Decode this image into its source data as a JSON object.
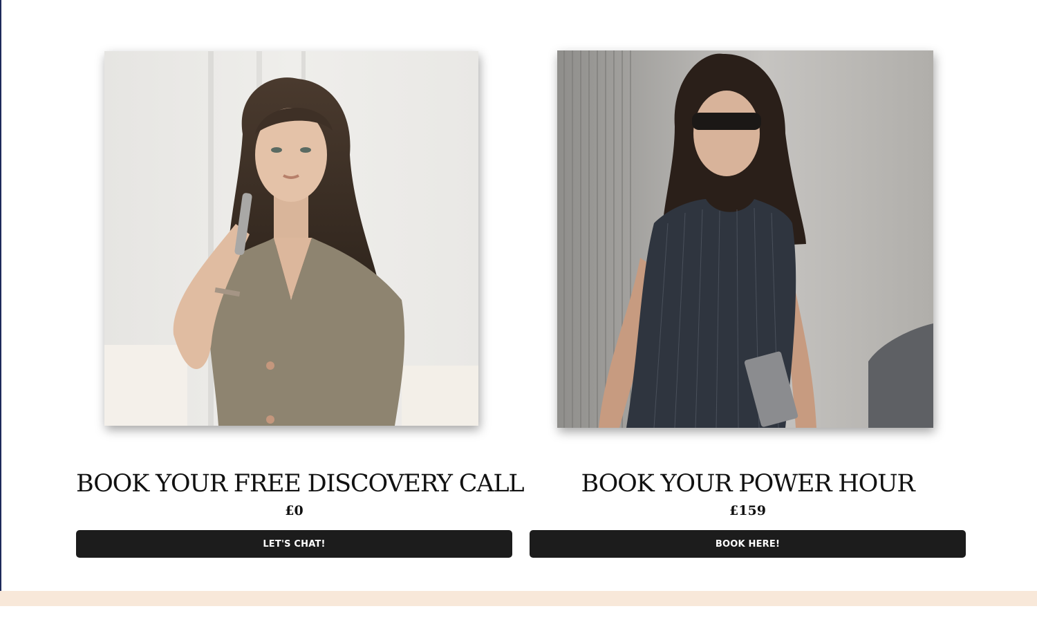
{
  "colors": {
    "button_background": "#1c1c1c",
    "button_text": "#ffffff",
    "footer_band": "#f8e8d9",
    "page_background": "#ffffff"
  },
  "cards": [
    {
      "title": "BOOK YOUR FREE DISCOVERY CALL",
      "price": "£0",
      "button_label": "LET'S CHAT!",
      "photo_alt": "Woman in a khaki dress talking on a phone"
    },
    {
      "title": "BOOK YOUR POWER HOUR",
      "price": "£159",
      "button_label": "BOOK HERE!",
      "photo_alt": "Woman in sunglasses and a pinstripe dress holding a laptop"
    }
  ]
}
